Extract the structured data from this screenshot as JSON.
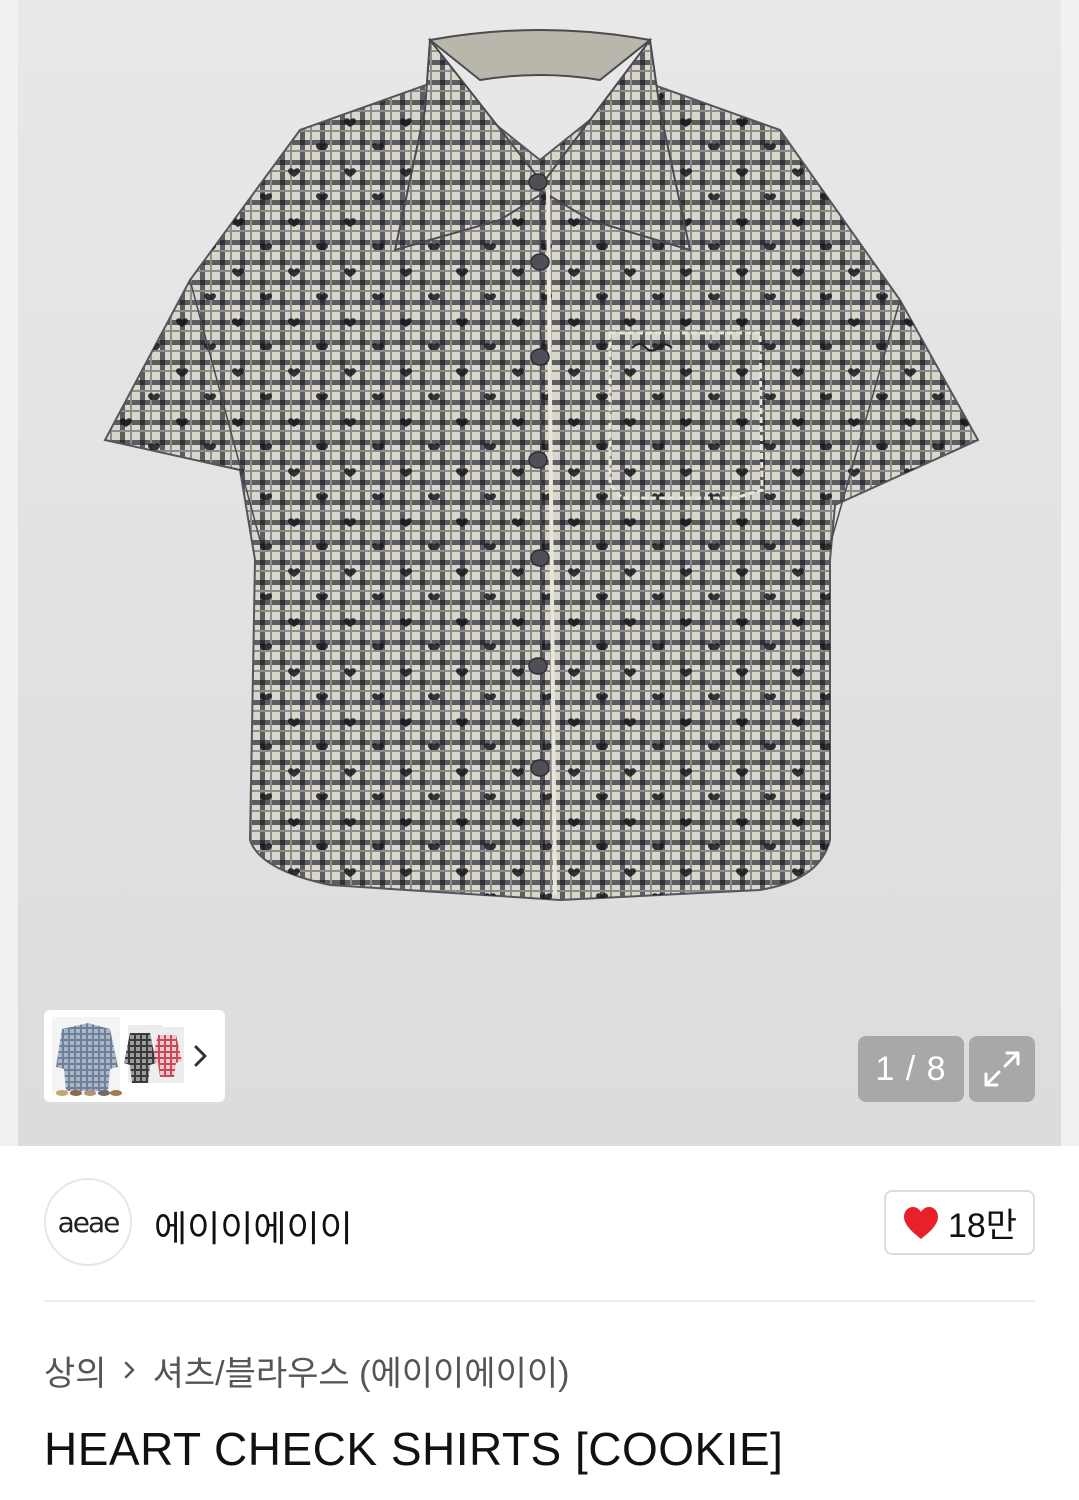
{
  "gallery": {
    "counter_current": "1",
    "counter_separator": "/",
    "counter_total": "8",
    "counter_text": "1 / 8"
  },
  "brand": {
    "logo_text": "aeae",
    "name": "에이이에이이",
    "likes": "18만",
    "like_icon": "heart-icon",
    "like_color": "#e8202a"
  },
  "breadcrumb": {
    "items": [
      "상의",
      "셔츠/블라우스 (에이이에이이)"
    ]
  },
  "product": {
    "title": "HEART CHECK SHIRTS [COOKIE]"
  }
}
